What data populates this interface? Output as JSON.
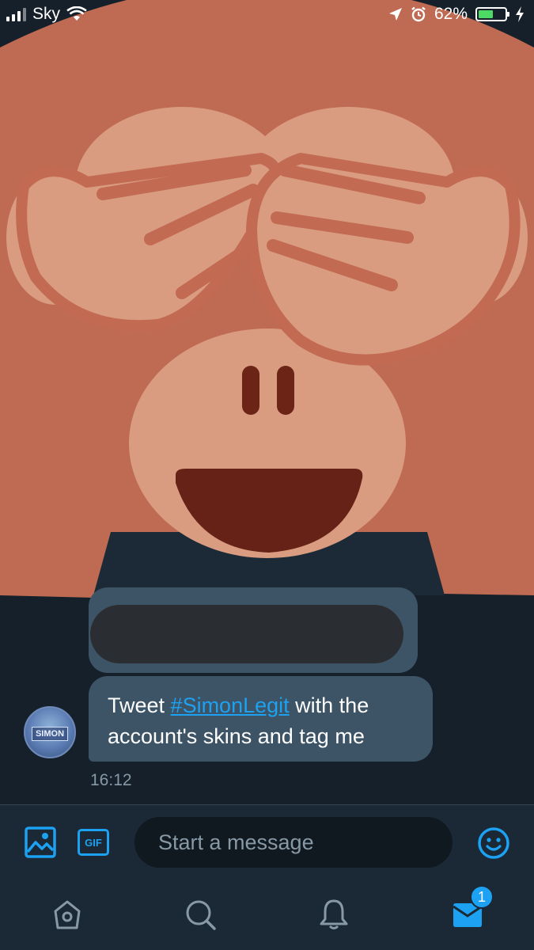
{
  "status_bar": {
    "carrier": "Sky",
    "battery_percent": "62%",
    "battery_level": 0.62
  },
  "background": {
    "image": "see-no-evil-monkey-emoji",
    "colors": {
      "fur": "#bf6a52",
      "face": "#d99c80",
      "outline": "#c26a52",
      "mouth": "#662217",
      "background": "#15202b"
    }
  },
  "conversation": {
    "avatar_text": "SIMON",
    "message_prefix": "Tweet ",
    "hashtag": "#SimonLegit",
    "message_suffix": " with the account's skins and tag me",
    "timestamp": "16:12"
  },
  "composer": {
    "placeholder": "Start a message",
    "gif_label": "GIF",
    "icons": [
      "image-icon",
      "gif-icon",
      "emoji-icon"
    ]
  },
  "tabbar": {
    "items": [
      "home-icon",
      "search-icon",
      "notifications-icon",
      "messages-icon"
    ],
    "messages_badge": "1",
    "accent": "#1da1f2",
    "inactive": "#8899a6"
  }
}
